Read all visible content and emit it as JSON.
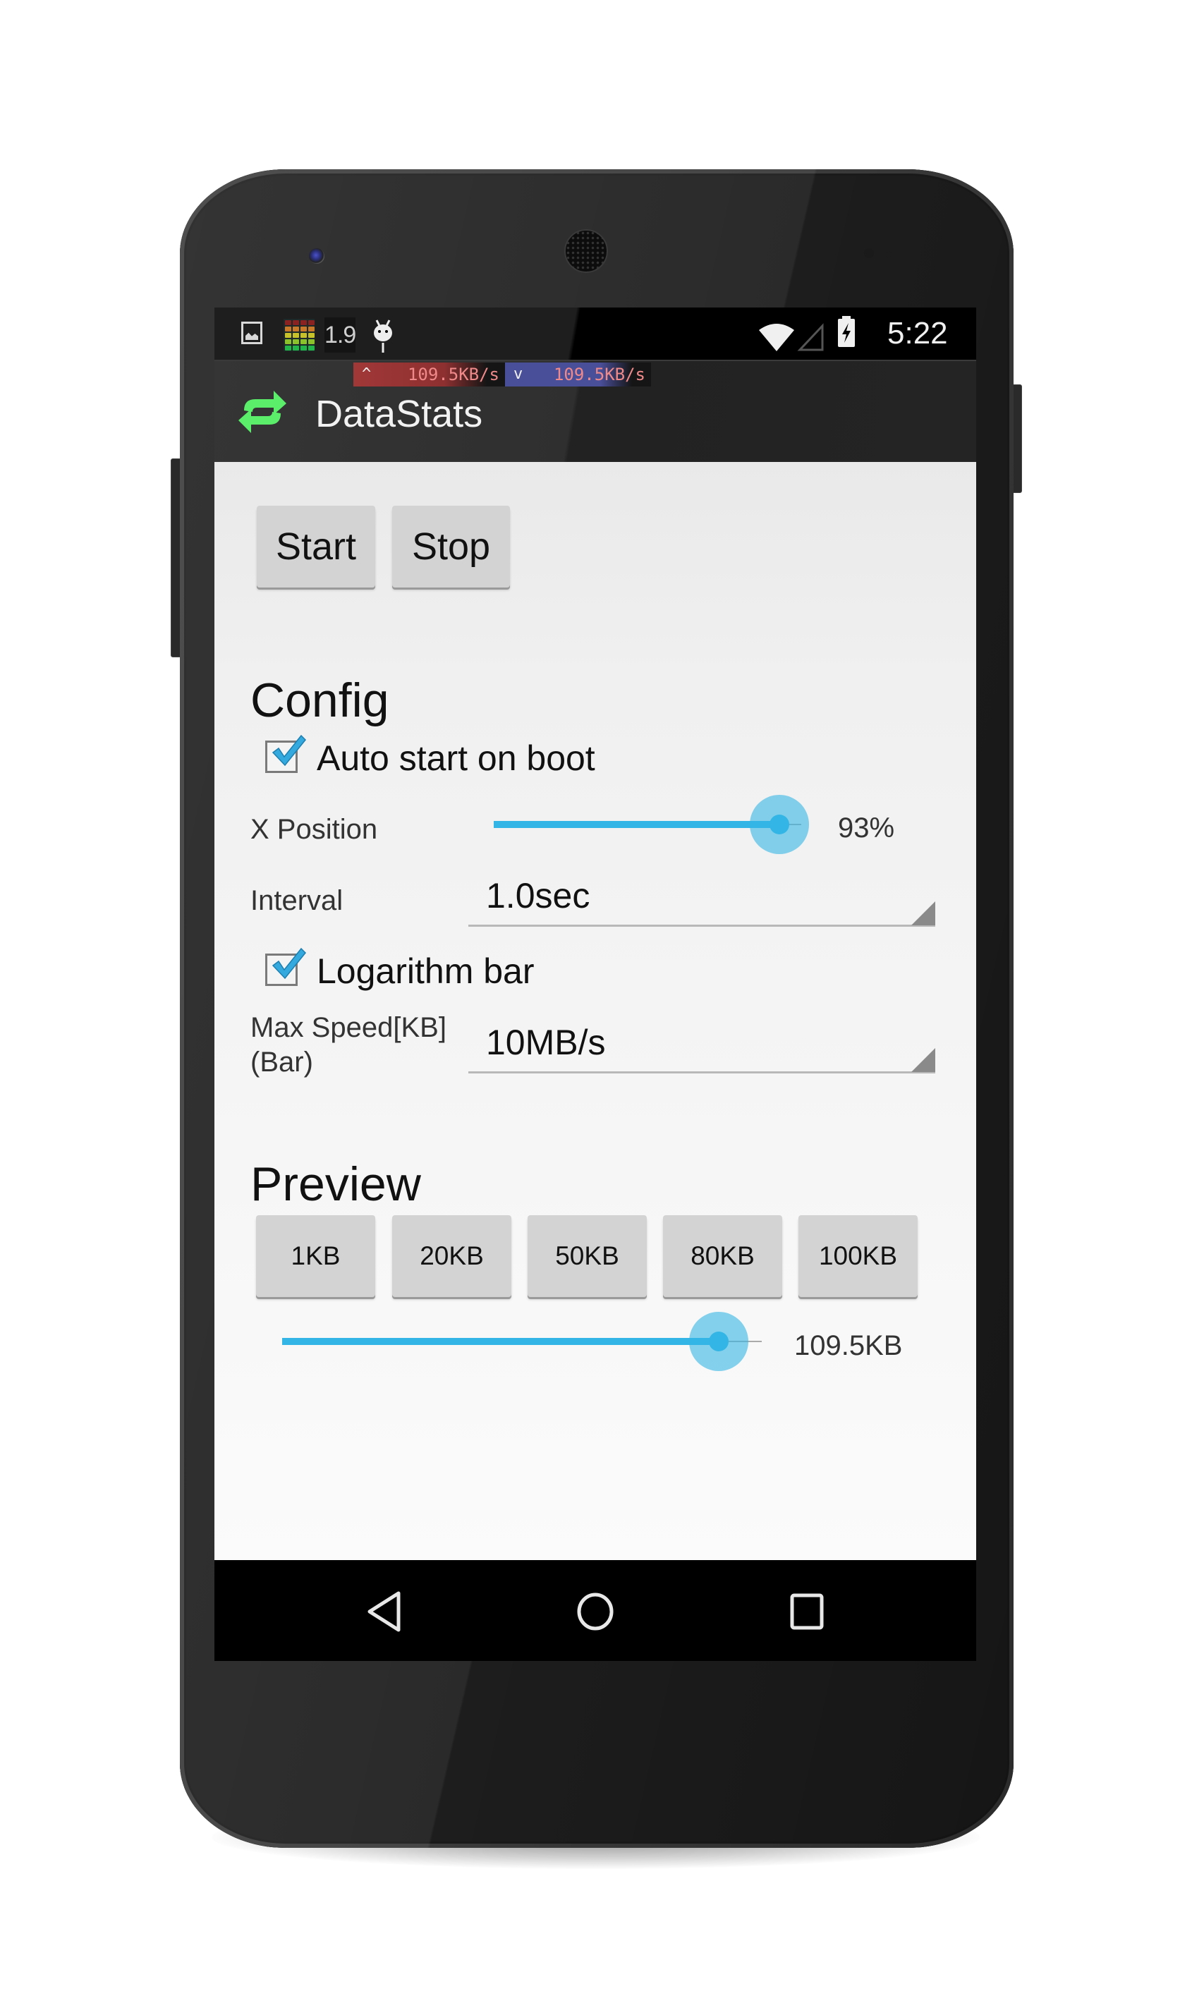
{
  "status_bar": {
    "icons_left": [
      "image-notification-icon",
      "level-meter-icon",
      "version-badge-icon",
      "android-debug-icon"
    ],
    "version_badge": "1.9",
    "icons_right": [
      "wifi-icon",
      "cell-signal-icon",
      "battery-charging-icon"
    ],
    "time": "5:22",
    "meter_colors": [
      "#8a2222",
      "#c9792a",
      "#c7c22a",
      "#8bc12b",
      "#23b54a"
    ]
  },
  "speed_overlay": {
    "upload": {
      "arrow": "^",
      "value": "109.5KB/s",
      "color": "#a13838"
    },
    "download": {
      "arrow": "v",
      "value": "109.5KB/s",
      "color": "#4a4f9a"
    }
  },
  "action_bar": {
    "title": "DataStats",
    "icon": "sync-arrows-icon",
    "icon_color": "#5bee6a"
  },
  "controls": {
    "start_label": "Start",
    "stop_label": "Stop"
  },
  "config": {
    "heading": "Config",
    "auto_start": {
      "label": "Auto start on boot",
      "checked": true
    },
    "x_position": {
      "label": "X Position",
      "value_percent": 93,
      "display": "93%"
    },
    "interval": {
      "label": "Interval",
      "selected": "1.0sec"
    },
    "logarithm_bar": {
      "label": "Logarithm bar",
      "checked": true
    },
    "max_speed": {
      "label_line1": "Max Speed[KB]",
      "label_line2": "(Bar)",
      "selected": "10MB/s"
    }
  },
  "preview": {
    "heading": "Preview",
    "buttons": [
      "1KB",
      "20KB",
      "50KB",
      "80KB",
      "100KB"
    ],
    "slider": {
      "fraction": 0.91,
      "display": "109.5KB"
    }
  },
  "nav_bar": {
    "back": "back-icon",
    "home": "home-icon",
    "recents": "recents-icon"
  },
  "theme": {
    "accent": "#33b5e5",
    "action_bar_bg": "#2d2d2d",
    "button_bg": "#d3d3d3"
  }
}
